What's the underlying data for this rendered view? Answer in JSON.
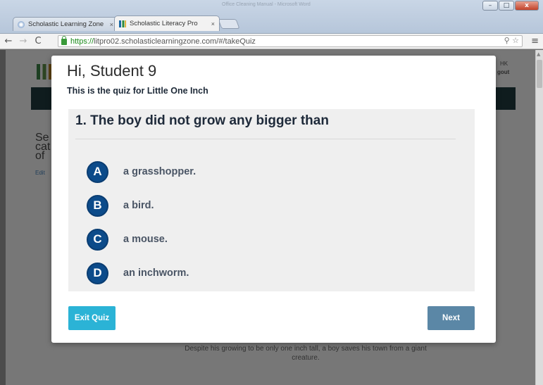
{
  "window": {
    "background_title": "Office Cleaning Manual - Microsoft Word",
    "controls": {
      "minimize": "–",
      "maximize": "□",
      "close": "x"
    }
  },
  "tabs": [
    {
      "label": "Scholastic Learning Zone",
      "close": "×"
    },
    {
      "label": "Scholastic Literacy Pro",
      "close": "×"
    }
  ],
  "toolbar": {
    "back": "←",
    "forward": "→",
    "reload": "C",
    "url_scheme": "https://",
    "url_rest": "litpro02.scholasticlearningzone.com/#/takeQuiz",
    "omni_icons": "⚲ ☆",
    "menu": "≡"
  },
  "background_page": {
    "side_text": "Se\ncat\nof",
    "edit_link": "Edit",
    "top_right_1": "HK",
    "top_right_2": "gout",
    "description": "Despite his growing to be only one inch tall, a boy saves his town from a giant creature."
  },
  "modal": {
    "greeting": "Hi, Student 9",
    "subtitle": "This is the quiz for Little One Inch",
    "question": "1. The boy did not grow any bigger than",
    "answers": [
      {
        "letter": "A",
        "text": "a grasshopper."
      },
      {
        "letter": "B",
        "text": "a bird."
      },
      {
        "letter": "C",
        "text": "a mouse."
      },
      {
        "letter": "D",
        "text": "an inchworm."
      }
    ],
    "exit_label": "Exit Quiz",
    "next_label": "Next"
  },
  "colors": {
    "badge": "#0c4b8a",
    "exit_button": "#2bb3d6",
    "next_button": "#5b87a6",
    "overlay": "#777777"
  }
}
